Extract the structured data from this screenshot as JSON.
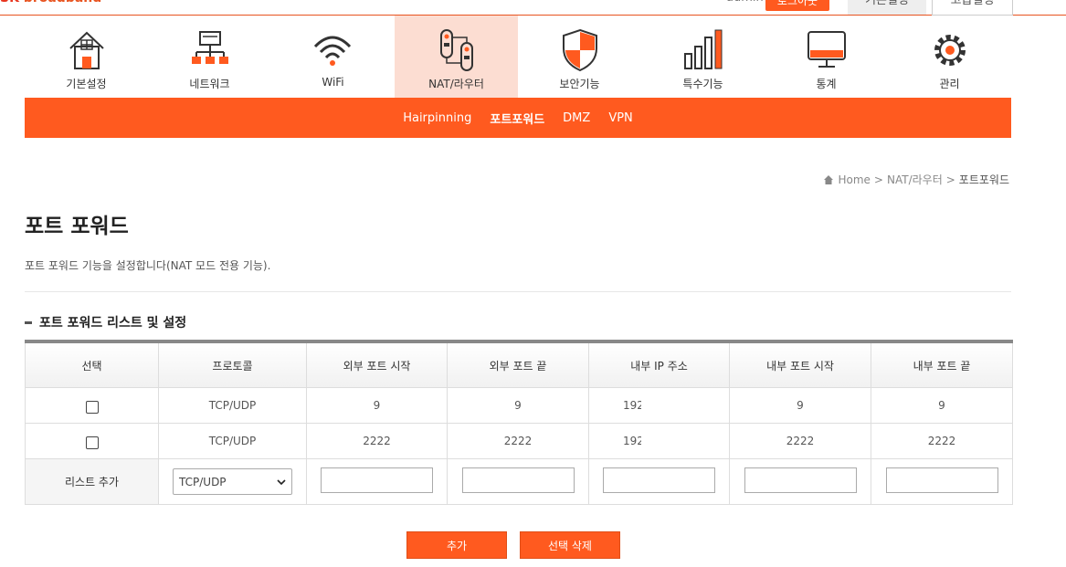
{
  "header": {
    "logo_mark": "SK",
    "logo_text": "broadband",
    "user": "admin",
    "logout": "로그아웃",
    "mode_basic": "기본설정",
    "mode_advanced": "고급설정"
  },
  "menu": [
    {
      "label": "기본설정",
      "icon": "house-icon"
    },
    {
      "label": "네트워크",
      "icon": "network-icon"
    },
    {
      "label": "WiFi",
      "icon": "wifi-icon"
    },
    {
      "label": "NAT/라우터",
      "icon": "router-icon"
    },
    {
      "label": "보안기능",
      "icon": "shield-icon"
    },
    {
      "label": "특수기능",
      "icon": "bars-icon"
    },
    {
      "label": "통계",
      "icon": "monitor-icon"
    },
    {
      "label": "관리",
      "icon": "gear-icon"
    }
  ],
  "submenu": [
    "Hairpinning",
    "포트포워드",
    "DMZ",
    "VPN"
  ],
  "breadcrumb": {
    "home": "Home",
    "sep1": ">",
    "parent": "NAT/라우터",
    "sep2": ">",
    "current": "포트포워드"
  },
  "page": {
    "title": "포트 포워드",
    "description": "포트 포워드 기능을 설정합니다(NAT 모드 전용 기능).",
    "section_title": "포트 포워드 리스트 및 설정"
  },
  "table": {
    "headers": [
      "선택",
      "프로토콜",
      "외부 포트 시작",
      "외부 포트 끝",
      "내부 IP 주소",
      "내부 포트 시작",
      "내부 포트 끝"
    ],
    "rows": [
      {
        "protocol": "TCP/UDP",
        "ext_start": "9",
        "ext_end": "9",
        "ip": "192",
        "int_start": "9",
        "int_end": "9"
      },
      {
        "protocol": "TCP/UDP",
        "ext_start": "2222",
        "ext_end": "2222",
        "ip": "192",
        "int_start": "2222",
        "int_end": "2222"
      }
    ],
    "add_row_label": "리스트 추가",
    "protocol_selected": "TCP/UDP"
  },
  "buttons": {
    "add": "추가",
    "delete_selected": "선택 삭제"
  },
  "colors": {
    "accent": "#ff5a1f",
    "active_menu_bg": "#fcddd2"
  }
}
